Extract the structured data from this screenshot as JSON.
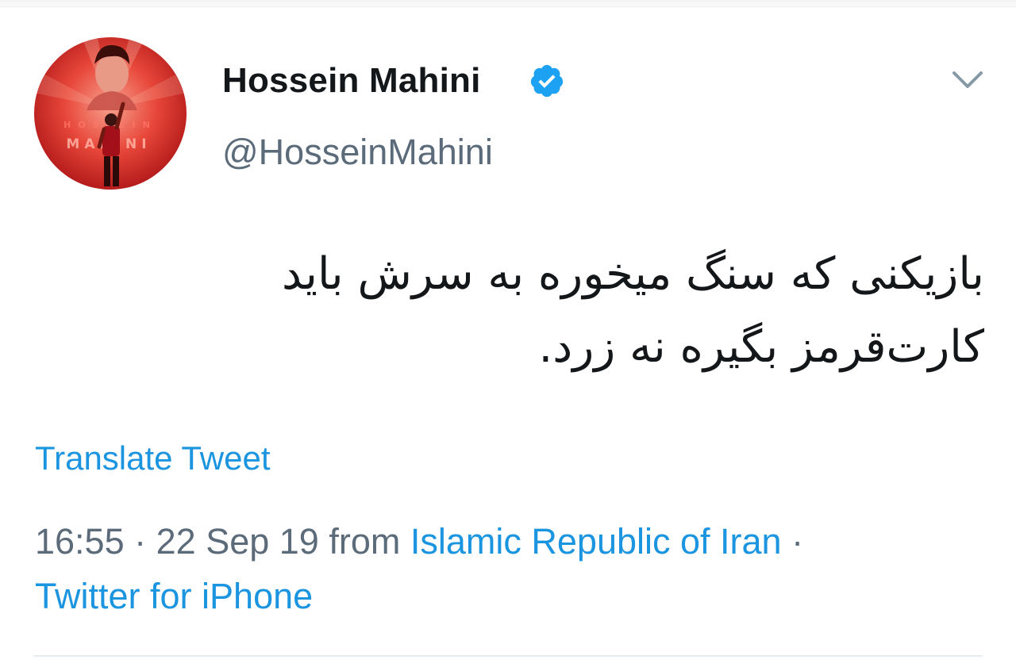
{
  "tweet": {
    "author": {
      "display_name": "Hossein Mahini",
      "handle": "@HosseinMahini",
      "verified": true,
      "avatar_caption_top": "HOSSEIN",
      "avatar_caption_bottom": "MAHINI"
    },
    "text_line_1": "بازیکنی که سنگ میخوره به سرش باید",
    "text_line_2": "کارت‌قرمز بگیره نه زرد.",
    "translate_label": "Translate Tweet",
    "time": "16:55",
    "separator": "·",
    "date": "22 Sep 19",
    "from_label": "from",
    "location": "Islamic Republic of Iran",
    "source": "Twitter for iPhone"
  },
  "colors": {
    "link": "#1b95e0",
    "meta": "#5c6b7a",
    "text": "#14171a",
    "verified": "#1da1f2"
  },
  "icons": {
    "verified": "verified-badge-icon",
    "menu": "chevron-down-icon"
  }
}
